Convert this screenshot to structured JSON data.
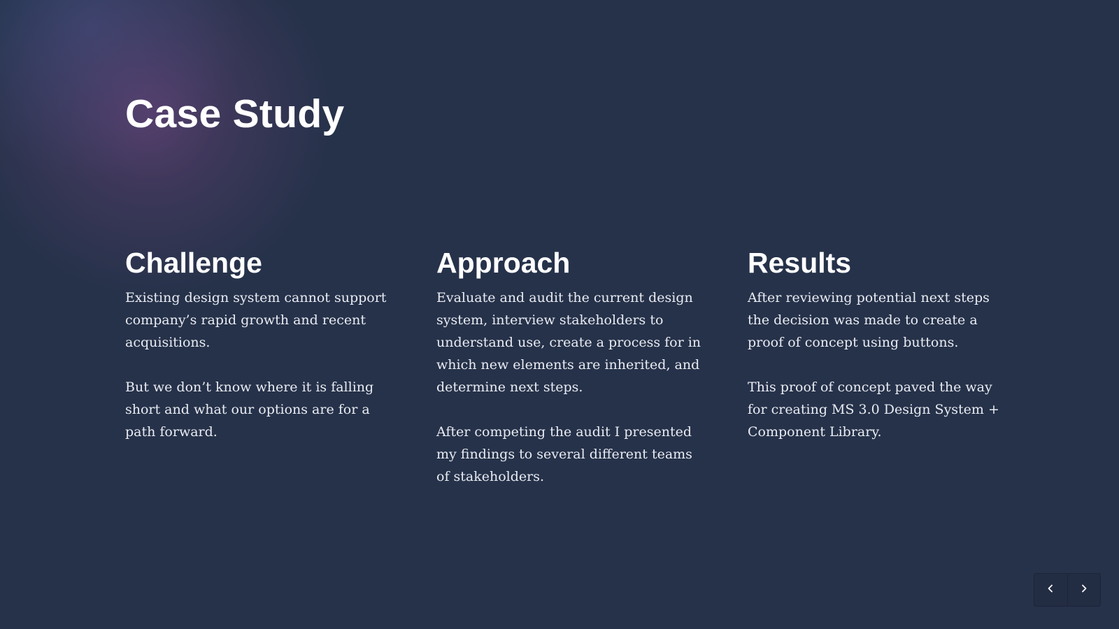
{
  "slide": {
    "title": "Case Study"
  },
  "columns": [
    {
      "heading": "Challenge",
      "paragraphs": [
        "Existing design system cannot support company’s rapid growth and recent acquisitions.",
        "But we don’t know where it is falling short and what our options are for a path forward."
      ]
    },
    {
      "heading": "Approach",
      "paragraphs": [
        "Evaluate and audit the current design system, interview stakeholders to understand use, create a process for in which new elements are inherited, and determine next steps.",
        "After competing the audit I presented my findings to several different teams of stakeholders."
      ]
    },
    {
      "heading": "Results",
      "paragraphs": [
        "After reviewing potential next steps the decision was made to create a proof of concept using buttons.",
        "This proof of concept paved the way for creating MS 3.0 Design System + Component Library."
      ]
    }
  ],
  "navigation": {
    "prev_icon": "chevron-left-icon",
    "next_icon": "chevron-right-icon"
  },
  "colors": {
    "background": "#26324a",
    "text": "#ffffff",
    "glow": "#7a4a86"
  }
}
